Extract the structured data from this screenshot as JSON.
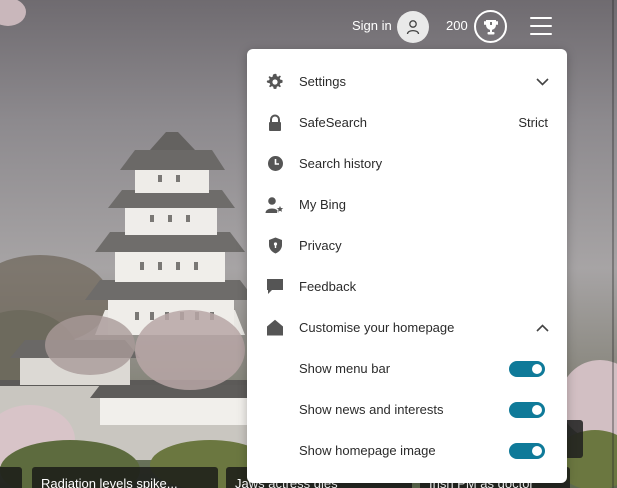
{
  "header": {
    "signin_label": "Sign in",
    "points": "200"
  },
  "menu": {
    "items": [
      {
        "label": "Settings",
        "icon": "gear-icon",
        "trailing": "chevron-down"
      },
      {
        "label": "SafeSearch",
        "icon": "lock-icon",
        "value": "Strict"
      },
      {
        "label": "Search history",
        "icon": "clock-icon"
      },
      {
        "label": "My Bing",
        "icon": "person-star-icon"
      },
      {
        "label": "Privacy",
        "icon": "shield-icon"
      },
      {
        "label": "Feedback",
        "icon": "feedback-icon"
      },
      {
        "label": "Customise your homepage",
        "icon": "home-icon",
        "trailing": "chevron-up"
      }
    ],
    "toggles": [
      {
        "label": "Show menu bar",
        "on": true
      },
      {
        "label": "Show news and interests",
        "on": true
      },
      {
        "label": "Show homepage image",
        "on": true
      }
    ]
  },
  "news": {
    "items": [
      {
        "label": "Radiation levels spike..."
      },
      {
        "label": "Jaws actress dies"
      },
      {
        "label": "Irish PM as doctor"
      }
    ]
  },
  "colors": {
    "accent": "#0f7a99",
    "panel_bg": "#ffffff",
    "icon": "#555555"
  }
}
